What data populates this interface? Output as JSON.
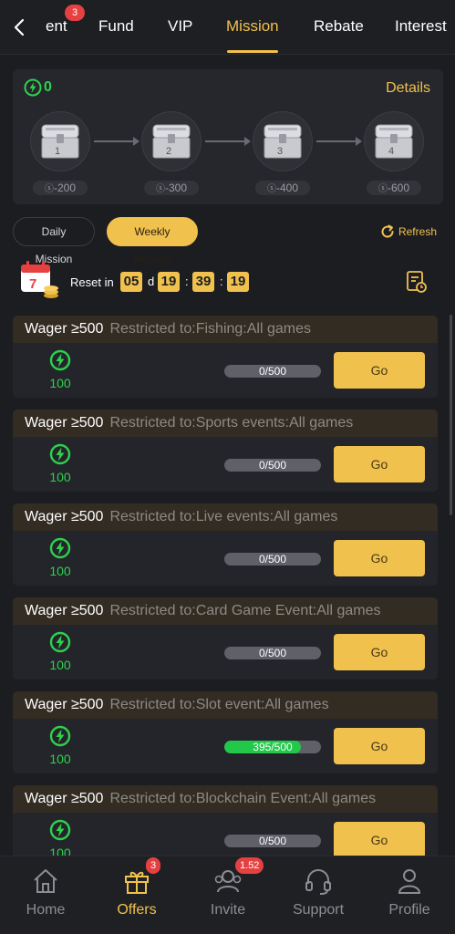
{
  "tabs": [
    {
      "label": "ent",
      "badge": "3"
    },
    {
      "label": "Fund"
    },
    {
      "label": "VIP"
    },
    {
      "label": "Mission"
    },
    {
      "label": "Rebate"
    },
    {
      "label": "Interest"
    }
  ],
  "active_tab": "Mission",
  "chest_panel": {
    "energy": "0",
    "details_label": "Details",
    "chests": [
      {
        "number": "1",
        "requirement": "-200"
      },
      {
        "number": "2",
        "requirement": "-300"
      },
      {
        "number": "3",
        "requirement": "-400"
      },
      {
        "number": "4",
        "requirement": "-600"
      }
    ]
  },
  "mission_types": {
    "daily": "Daily Mission",
    "weekly": "Weekly Mission",
    "active": "Weekly Mission"
  },
  "refresh_label": "Refresh",
  "reset": {
    "label": "Reset in",
    "days": "05",
    "day_unit": "d",
    "hours": "19",
    "minutes": "39",
    "seconds": "19",
    "sep": ":"
  },
  "missions": [
    {
      "title": "Wager ≥500",
      "restriction": "Restricted to:Fishing:All games",
      "reward": "100",
      "progress_text": "0/500",
      "progress": 0,
      "button": "Go"
    },
    {
      "title": "Wager ≥500",
      "restriction": "Restricted to:Sports events:All games",
      "reward": "100",
      "progress_text": "0/500",
      "progress": 0,
      "button": "Go"
    },
    {
      "title": "Wager ≥500",
      "restriction": "Restricted to:Live events:All games",
      "reward": "100",
      "progress_text": "0/500",
      "progress": 0,
      "button": "Go"
    },
    {
      "title": "Wager ≥500",
      "restriction": "Restricted to:Card Game Event:All games",
      "reward": "100",
      "progress_text": "0/500",
      "progress": 0,
      "button": "Go"
    },
    {
      "title": "Wager ≥500",
      "restriction": "Restricted to:Slot event:All games",
      "reward": "100",
      "progress_text": "395/500",
      "progress": 0.79,
      "button": "Go"
    },
    {
      "title": "Wager ≥500",
      "restriction": "Restricted to:Blockchain Event:All games",
      "reward": "100",
      "progress_text": "0/500",
      "progress": 0,
      "button": "Go"
    }
  ],
  "bottom_nav": [
    {
      "label": "Home",
      "icon": "home-icon"
    },
    {
      "label": "Offers",
      "icon": "gift-icon",
      "badge": "3"
    },
    {
      "label": "Invite",
      "icon": "invite-icon",
      "badge": "1.52"
    },
    {
      "label": "Support",
      "icon": "headset-icon"
    },
    {
      "label": "Profile",
      "icon": "profile-icon"
    }
  ],
  "active_nav": "Offers",
  "colors": {
    "accent": "#f1c14e",
    "energy_green": "#2ed14d",
    "badge_red": "#e64040",
    "background": "#1c1d21"
  }
}
